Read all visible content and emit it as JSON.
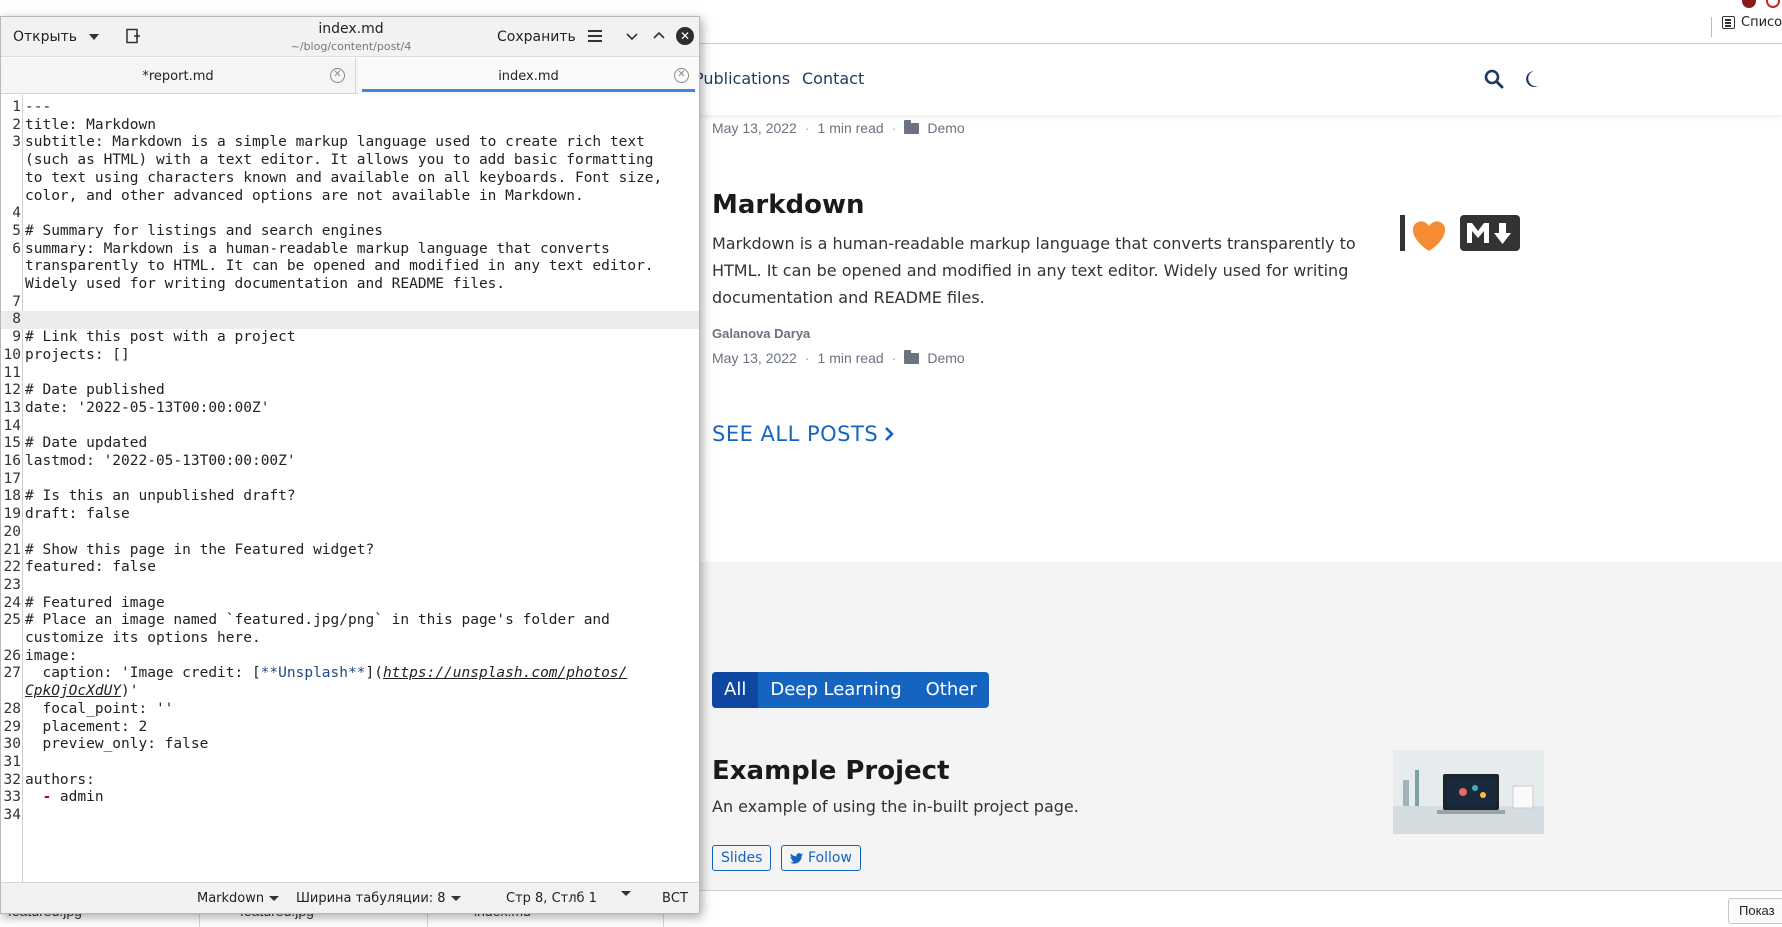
{
  "browser": {
    "reading_list_label": "Списо",
    "nav": {
      "publications": "Publications",
      "contact": "Contact"
    },
    "post1": {
      "date": "May 13, 2022",
      "read": "1 min read",
      "category": "Demo"
    },
    "post2": {
      "title": "Markdown",
      "summary": "Markdown is a human-readable markup language that converts transparently to HTML. It can be opened and modified in any text editor. Widely used for writing documentation and README files.",
      "author": "Galanova Darya",
      "date": "May 13, 2022",
      "read": "1 min read",
      "category": "Demo"
    },
    "see_all": "SEE ALL POSTS",
    "filters": [
      "All",
      "Deep Learning",
      "Other"
    ],
    "project": {
      "title": "Example Project",
      "description": "An example of using the in-built project page.",
      "slides": "Slides",
      "follow": "Follow"
    },
    "downloads": [
      {
        "name": "featured.jpg"
      },
      {
        "name": "featured.jpg"
      },
      {
        "name": "index.md"
      }
    ],
    "show_all": "Показ",
    "colors": {
      "accent": "#1565c0",
      "heart": "#f58b33",
      "md_badge": "#333333"
    },
    "icons": [
      "reading-list-icon",
      "search-icon",
      "moon-icon",
      "folder-icon",
      "chevron-right-icon",
      "twitter-icon",
      "heart-icon",
      "markdown-icon",
      "close-icon"
    ]
  },
  "editor": {
    "open_label": "Открыть",
    "title": "index.md",
    "path": "~/blog/content/post/4",
    "save_label": "Сохранить",
    "tabs": [
      {
        "label": "*report.md"
      },
      {
        "label": "index.md"
      }
    ],
    "code": [
      {
        "n": "1",
        "t": "---",
        "c": "cm"
      },
      {
        "n": "2",
        "t": "title: Markdown"
      },
      {
        "n": "3",
        "t": "subtitle: Markdown is a simple markup language used to create rich text"
      },
      {
        "n": "",
        "t": "(such as HTML) with a text editor. It allows you to add basic formatting"
      },
      {
        "n": "",
        "t": "to text using characters known and available on all keyboards. Font size,"
      },
      {
        "n": "",
        "t": "color, and other advanced options are not available in Markdown."
      },
      {
        "n": "4",
        "t": ""
      },
      {
        "n": "5",
        "t": "# Summary for listings and search engines",
        "c": "cm"
      },
      {
        "n": "6",
        "t": "summary: Markdown is a human-readable markup language that converts"
      },
      {
        "n": "",
        "t": "transparently to HTML. It can be opened and modified in any text editor."
      },
      {
        "n": "",
        "t": "Widely used for writing documentation and README files."
      },
      {
        "n": "7",
        "t": ""
      },
      {
        "n": "8",
        "t": "",
        "cur": true
      },
      {
        "n": "9",
        "t": "# Link this post with a project",
        "c": "cm"
      },
      {
        "n": "10",
        "t": "projects: []"
      },
      {
        "n": "11",
        "t": ""
      },
      {
        "n": "12",
        "t": "# Date published",
        "c": "cm"
      },
      {
        "n": "13",
        "t": "date: '2022-05-13T00:00:00Z'"
      },
      {
        "n": "14",
        "t": ""
      },
      {
        "n": "15",
        "t": "# Date updated",
        "c": "cm"
      },
      {
        "n": "16",
        "t": "lastmod: '2022-05-13T00:00:00Z'"
      },
      {
        "n": "17",
        "t": ""
      },
      {
        "n": "18",
        "t": "# Is this an unpublished draft?",
        "c": "cm"
      },
      {
        "n": "19",
        "t": "draft: false"
      },
      {
        "n": "20",
        "t": ""
      },
      {
        "n": "21",
        "t": "# Show this page in the Featured widget?",
        "c": "cm"
      },
      {
        "n": "22",
        "t": "featured: false"
      },
      {
        "n": "23",
        "t": ""
      },
      {
        "n": "24",
        "t": "# Featured image",
        "c": "cm"
      },
      {
        "n": "25",
        "t": "# Place an image named `featured.jpg/png` in this page's folder and",
        "c": "cm"
      },
      {
        "n": "",
        "t": "customize its options here.",
        "c": "cm"
      },
      {
        "n": "26",
        "t": "image:"
      },
      {
        "n": "27",
        "t": "  caption: 'Image credit: [**Unsplash**](https://unsplash.com/photos/",
        "special": "caption"
      },
      {
        "n": "",
        "t": "CpkOjOcXdUY)'",
        "special": "caption2"
      },
      {
        "n": "28",
        "t": "  focal_point: ''"
      },
      {
        "n": "29",
        "t": "  placement: 2"
      },
      {
        "n": "30",
        "t": "  preview_only: false"
      },
      {
        "n": "31",
        "t": ""
      },
      {
        "n": "32",
        "t": "authors:"
      },
      {
        "n": "33",
        "t": "  - admin",
        "special": "dash"
      },
      {
        "n": "34",
        "t": ""
      }
    ],
    "status": {
      "language": "Markdown",
      "tab_width": "Ширина табуляции: 8",
      "position": "Стр 8, Стлб 1",
      "mode": "ВСТ"
    }
  }
}
